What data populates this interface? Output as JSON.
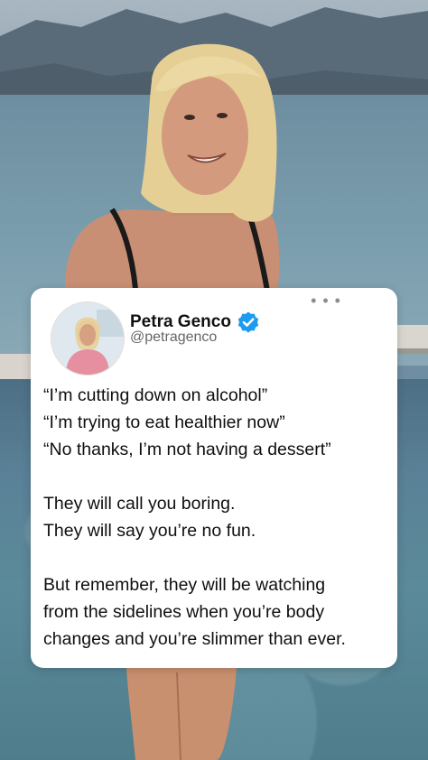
{
  "post": {
    "author_name": "Petra Genco",
    "author_handle": "@petragenco",
    "more_icon": "more-dots-icon",
    "verified_icon": "verified-badge-icon",
    "verified_color": "#1d9bf0",
    "paragraphs": [
      [
        "“I’m cutting down on alcohol”",
        "“I’m trying to eat healthier now”",
        "“No thanks, I’m not having a dessert”"
      ],
      [
        "They will call you boring.",
        "They will say you’re no fun."
      ],
      [
        "But remember, they will be watching",
        "from the sidelines when you’re body",
        "changes and you’re slimmer than ever."
      ]
    ]
  }
}
